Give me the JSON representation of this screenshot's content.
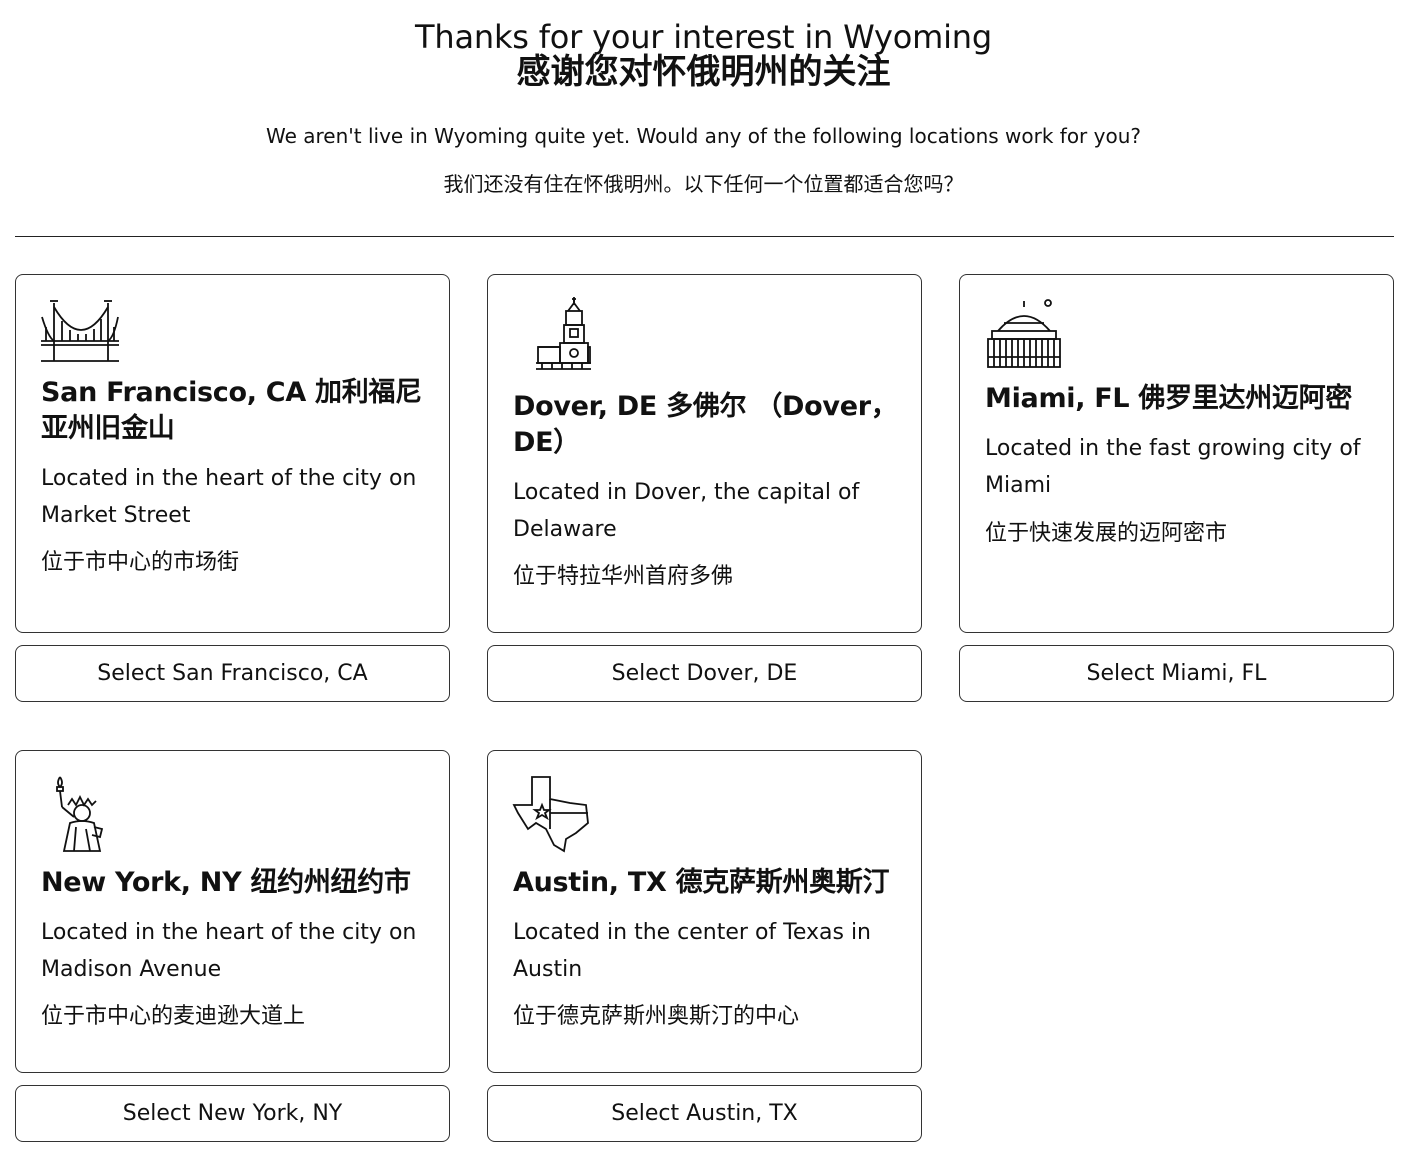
{
  "header": {
    "title": "Thanks for your interest in Wyoming",
    "title_zh": "感谢您对怀俄明州的关注",
    "subtitle": "We aren't live in Wyoming quite yet. Would any of the following locations work for you?",
    "subtitle_zh": "我们还没有住在怀俄明州。以下任何一个位置都适合您吗？"
  },
  "locations": [
    {
      "title": "San Francisco, CA 加利福尼亚州旧金山",
      "desc": "Located in the heart of the city on Market Street",
      "desc_zh": "位于市中心的市场街",
      "button": "Select San Francisco, CA",
      "icon": "golden-gate-bridge-icon"
    },
    {
      "title": "Dover, DE 多佛尔 （Dover，DE）",
      "desc": "Located in Dover, the capital of Delaware",
      "desc_zh": "位于特拉华州首府多佛",
      "button": "Select Dover, DE",
      "icon": "independence-hall-icon"
    },
    {
      "title": "Miami, FL 佛罗里达州迈阿密",
      "desc": "Located in the fast growing city of Miami",
      "desc_zh": "位于快速发展的迈阿密市",
      "button": "Select Miami, FL",
      "icon": "domed-building-icon"
    },
    {
      "title": "New York, NY 纽约州纽约市",
      "desc": "Located in the heart of the city on Madison Avenue",
      "desc_zh": "位于市中心的麦迪逊大道上",
      "button": "Select New York, NY",
      "icon": "statue-of-liberty-icon"
    },
    {
      "title": "Austin, TX 德克萨斯州奥斯汀",
      "desc": "Located in the center of Texas in Austin",
      "desc_zh": "位于德克萨斯州奥斯汀的中心",
      "button": "Select Austin, TX",
      "icon": "texas-flag-map-icon"
    }
  ]
}
